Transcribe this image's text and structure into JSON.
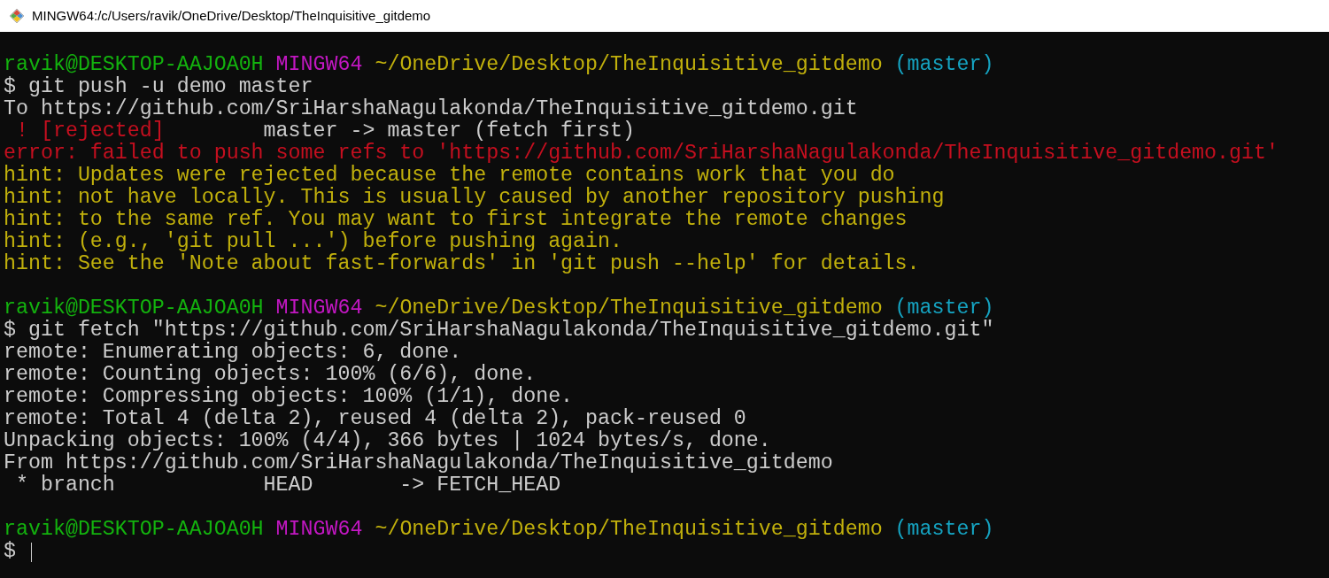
{
  "window": {
    "title": "MINGW64:/c/Users/ravik/OneDrive/Desktop/TheInquisitive_gitdemo"
  },
  "blocks": [
    {
      "lines": [
        {
          "segments": [
            {
              "text": "ravik@DESKTOP-AAJOA0H",
              "color": "#13b20e"
            },
            {
              "text": " MINGW64",
              "color": "#c317c3"
            },
            {
              "text": " ~/OneDrive/Desktop/TheInquisitive_gitdemo",
              "color": "#c1b00c"
            },
            {
              "text": " (master)",
              "color": "#15a3c1"
            }
          ]
        },
        {
          "segments": [
            {
              "text": "$ git push -u demo master",
              "color": "#cccccc"
            }
          ]
        },
        {
          "segments": [
            {
              "text": "To https://github.com/SriHarshaNagulakonda/TheInquisitive_gitdemo.git",
              "color": "#cccccc"
            }
          ]
        },
        {
          "segments": [
            {
              "text": " ! [rejected]",
              "color": "#c50f1f"
            },
            {
              "text": "        master -> master (fetch first)",
              "color": "#cccccc"
            }
          ]
        },
        {
          "segments": [
            {
              "text": "error: failed to push some refs to 'https://github.com/SriHarshaNagulakonda/TheInquisitive_gitdemo.git'",
              "color": "#c50f1f"
            }
          ]
        },
        {
          "segments": [
            {
              "text": "hint: Updates were rejected because the remote contains work that you do",
              "color": "#c1b00c"
            }
          ]
        },
        {
          "segments": [
            {
              "text": "hint: not have locally. This is usually caused by another repository pushing",
              "color": "#c1b00c"
            }
          ]
        },
        {
          "segments": [
            {
              "text": "hint: to the same ref. You may want to first integrate the remote changes",
              "color": "#c1b00c"
            }
          ]
        },
        {
          "segments": [
            {
              "text": "hint: (e.g., 'git pull ...') before pushing again.",
              "color": "#c1b00c"
            }
          ]
        },
        {
          "segments": [
            {
              "text": "hint: See the 'Note about fast-forwards' in 'git push --help' for details.",
              "color": "#c1b00c"
            }
          ]
        }
      ]
    },
    {
      "lines": [
        {
          "segments": [
            {
              "text": "ravik@DESKTOP-AAJOA0H",
              "color": "#13b20e"
            },
            {
              "text": " MINGW64",
              "color": "#c317c3"
            },
            {
              "text": " ~/OneDrive/Desktop/TheInquisitive_gitdemo",
              "color": "#c1b00c"
            },
            {
              "text": " (master)",
              "color": "#15a3c1"
            }
          ]
        },
        {
          "segments": [
            {
              "text": "$ git fetch \"https://github.com/SriHarshaNagulakonda/TheInquisitive_gitdemo.git\"",
              "color": "#cccccc"
            }
          ]
        },
        {
          "segments": [
            {
              "text": "remote: Enumerating objects: 6, done.",
              "color": "#cccccc"
            }
          ]
        },
        {
          "segments": [
            {
              "text": "remote: Counting objects: 100% (6/6), done.",
              "color": "#cccccc"
            }
          ]
        },
        {
          "segments": [
            {
              "text": "remote: Compressing objects: 100% (1/1), done.",
              "color": "#cccccc"
            }
          ]
        },
        {
          "segments": [
            {
              "text": "remote: Total 4 (delta 2), reused 4 (delta 2), pack-reused 0",
              "color": "#cccccc"
            }
          ]
        },
        {
          "segments": [
            {
              "text": "Unpacking objects: 100% (4/4), 366 bytes | 1024 bytes/s, done.",
              "color": "#cccccc"
            }
          ]
        },
        {
          "segments": [
            {
              "text": "From https://github.com/SriHarshaNagulakonda/TheInquisitive_gitdemo",
              "color": "#cccccc"
            }
          ]
        },
        {
          "segments": [
            {
              "text": " * branch            HEAD       -> FETCH_HEAD",
              "color": "#cccccc"
            }
          ]
        }
      ]
    },
    {
      "lines": [
        {
          "segments": [
            {
              "text": "ravik@DESKTOP-AAJOA0H",
              "color": "#13b20e"
            },
            {
              "text": " MINGW64",
              "color": "#c317c3"
            },
            {
              "text": " ~/OneDrive/Desktop/TheInquisitive_gitdemo",
              "color": "#c1b00c"
            },
            {
              "text": " (master)",
              "color": "#15a3c1"
            }
          ]
        },
        {
          "segments": [
            {
              "text": "$",
              "color": "#cccccc"
            }
          ],
          "cursor": true
        }
      ]
    }
  ]
}
